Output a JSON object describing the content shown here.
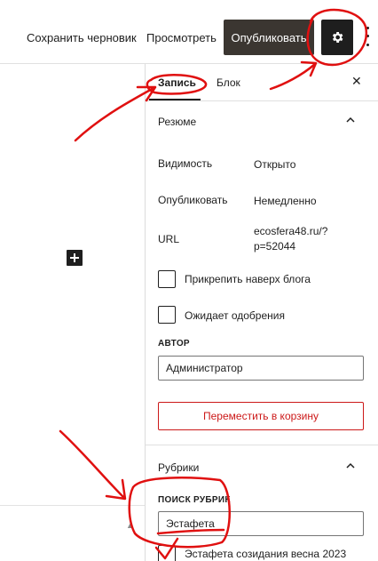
{
  "toolbar": {
    "save_draft": "Сохранить черновик",
    "preview": "Просмотреть",
    "publish": "Опубликовать"
  },
  "sidebar": {
    "tabs": [
      "Запись",
      "Блок"
    ],
    "close_symbol": "✕",
    "summary": {
      "title": "Резюме",
      "rows": [
        {
          "label": "Видимость",
          "value": "Открыто"
        },
        {
          "label": "Опубликовать",
          "value": "Немедленно"
        },
        {
          "label": "URL",
          "value": "ecosfera48.ru/?\np=52044"
        }
      ],
      "stick_label": "Прикрепить наверх блога",
      "pending_label": "Ожидает одобрения",
      "author_label": "АВТОР",
      "author_value": "Администратор",
      "trash_label": "Переместить в корзину"
    },
    "categories": {
      "title": "Рубрики",
      "search_label": "ПОИСК РУБРИК",
      "search_value": "Эстафета",
      "result_label": "Эстафета созидания весна 2023"
    }
  },
  "icons": {
    "settings": "gear-icon",
    "more": "more-vertical-icon",
    "add_block": "plus-icon",
    "chevron": "chevron-up-icon"
  },
  "colors": {
    "publish_bg": "#3b3631",
    "trash": "#cc1818",
    "annotation": "#e01010"
  }
}
